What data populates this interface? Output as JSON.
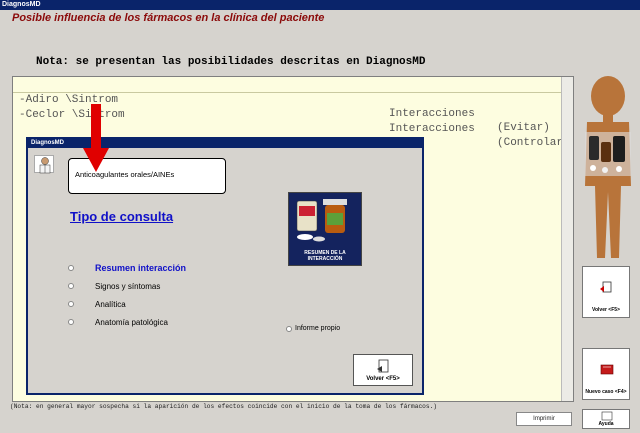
{
  "window": {
    "title": "DiagnosMD"
  },
  "header": {
    "heading": "Posible influencia de los fármacos en la clínica del paciente",
    "nota": "Nota: se presentan las posibilidades descritas en DiagnosMD"
  },
  "list": {
    "rows": [
      {
        "drug": "-Adiro \\Sintrom",
        "type": "Interacciones",
        "action": "(Evitar)"
      },
      {
        "drug": "-Ceclor \\Sintrom",
        "type": "Interacciones",
        "action": "(Controlar"
      }
    ]
  },
  "footnote": "(Nota: en general mayor sospecha si la aparición de los efectos coincide con el inicio de la toma de los fármacos.)",
  "buttons": {
    "imprimir": "Imprimir",
    "volver_side": "Volver <F5>",
    "nuevo_caso": "Nuevo caso <F4>",
    "ayuda": "Ayuda"
  },
  "dialog": {
    "title": "DiagnosMD",
    "drug_group": "Anticoagulantes orales/AINEs",
    "tipo": "Tipo de consulta",
    "options": [
      "Resumen interacción",
      "Signos y síntomas",
      "Analítica",
      "Anatomía patológica"
    ],
    "informe": "Informe propio",
    "image_caption": "RESUMEN DE LA INTERACCIÓN",
    "volver": "Volver <F5>"
  },
  "colors": {
    "heading": "#8b0a0a",
    "link": "#1010c8",
    "list_bg": "#fdfde0",
    "arrow": "#e00000",
    "figure": "#b8743a"
  }
}
